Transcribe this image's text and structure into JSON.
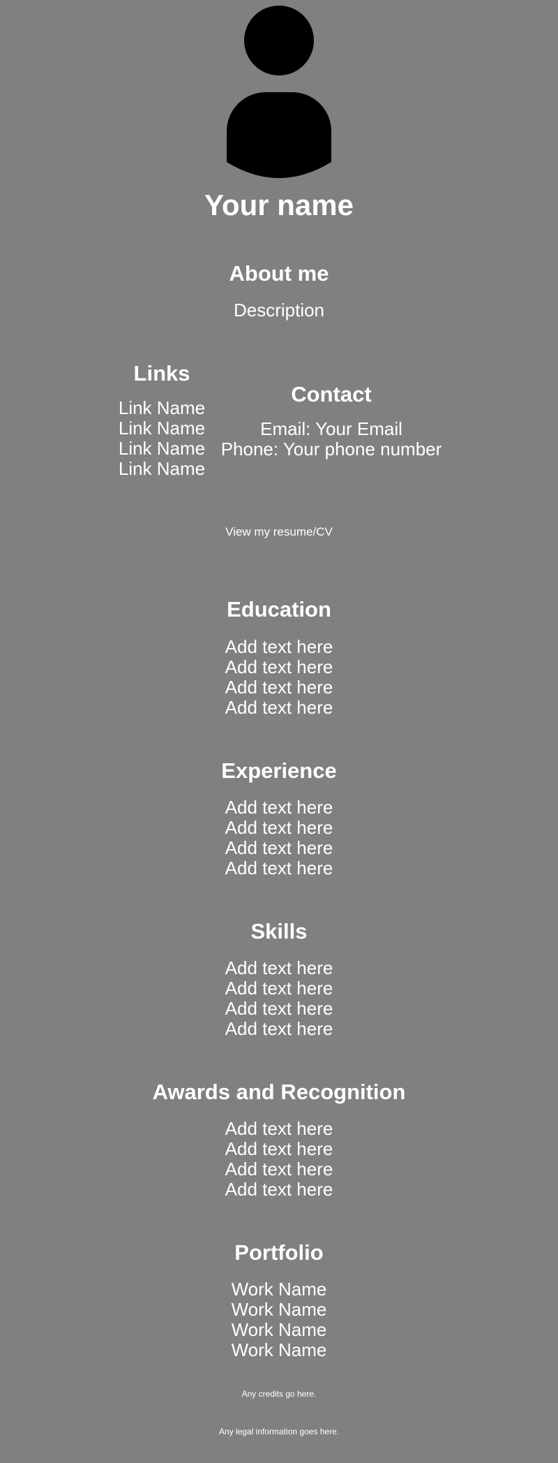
{
  "header": {
    "name": "Your name"
  },
  "about": {
    "heading": "About me",
    "description": "Description"
  },
  "links": {
    "heading": "Links",
    "items": [
      "Link Name",
      "Link Name",
      "Link Name",
      "Link Name"
    ]
  },
  "contact": {
    "heading": "Contact",
    "email": "Email: Your Email",
    "phone": "Phone: Your phone number"
  },
  "resume": {
    "label": "View my resume/CV"
  },
  "education": {
    "heading": "Education",
    "items": [
      "Add text here",
      "Add text here",
      "Add text here",
      "Add text here"
    ]
  },
  "experience": {
    "heading": "Experience",
    "items": [
      "Add text here",
      "Add text here",
      "Add text here",
      "Add text here"
    ]
  },
  "skills": {
    "heading": "Skills",
    "items": [
      "Add text here",
      "Add text here",
      "Add text here",
      "Add text here"
    ]
  },
  "awards": {
    "heading": "Awards and Recognition",
    "items": [
      "Add text here",
      "Add text here",
      "Add text here",
      "Add text here"
    ]
  },
  "portfolio": {
    "heading": "Portfolio",
    "items": [
      "Work Name",
      "Work Name",
      "Work Name",
      "Work Name"
    ]
  },
  "footer": {
    "credits": "Any credits go here.",
    "legal": "Any legal information goes here."
  },
  "colors": {
    "background": "#808080",
    "text": "#ffffff",
    "avatar": "#000000"
  }
}
